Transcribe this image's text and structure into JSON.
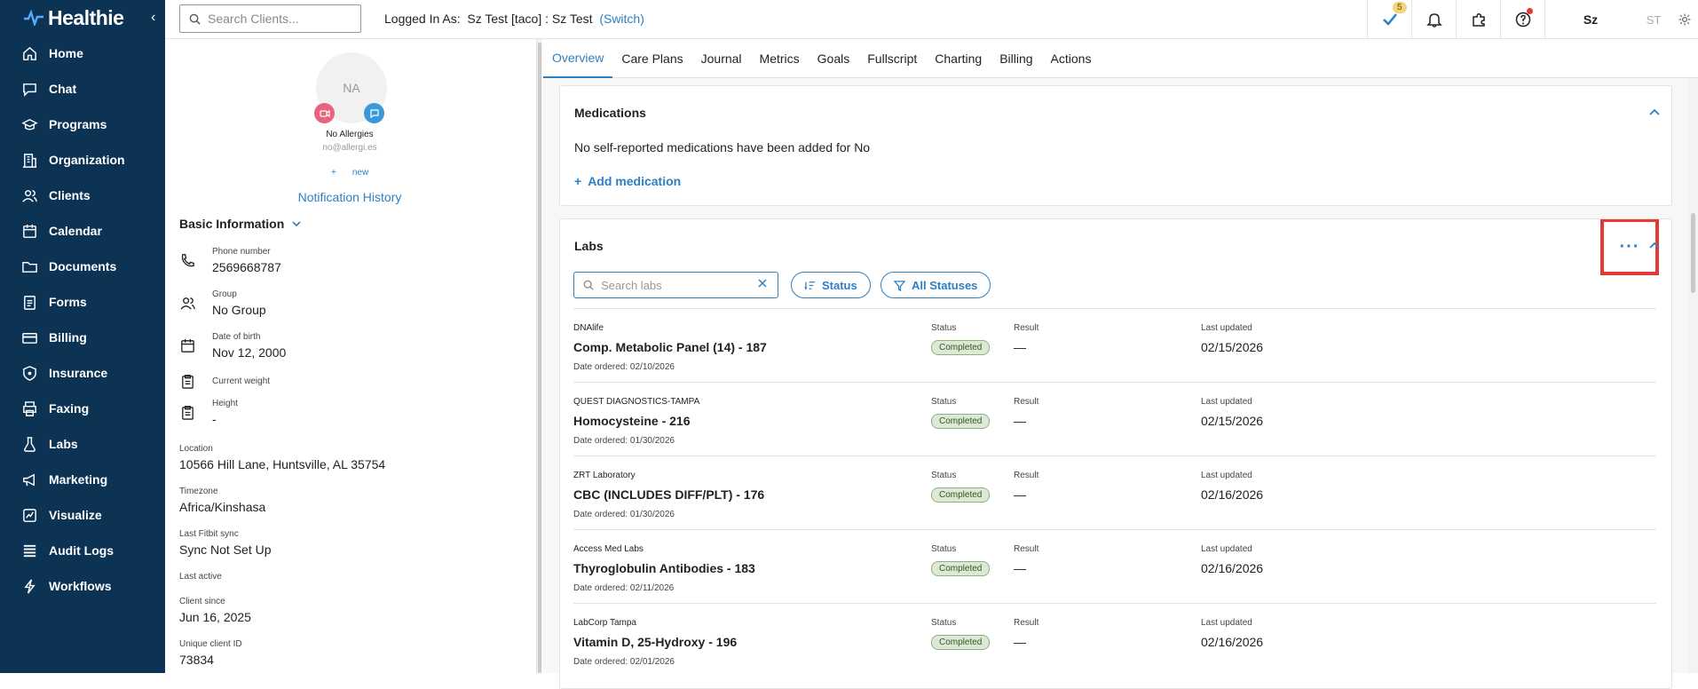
{
  "app": {
    "name": "Healthie"
  },
  "sidebar": {
    "items": [
      {
        "label": "Home",
        "icon": "home-icon"
      },
      {
        "label": "Chat",
        "icon": "chat-icon"
      },
      {
        "label": "Programs",
        "icon": "programs-icon"
      },
      {
        "label": "Organization",
        "icon": "organization-icon"
      },
      {
        "label": "Clients",
        "icon": "clients-icon"
      },
      {
        "label": "Calendar",
        "icon": "calendar-icon"
      },
      {
        "label": "Documents",
        "icon": "documents-icon"
      },
      {
        "label": "Forms",
        "icon": "forms-icon"
      },
      {
        "label": "Billing",
        "icon": "billing-icon"
      },
      {
        "label": "Insurance",
        "icon": "insurance-icon"
      },
      {
        "label": "Faxing",
        "icon": "fax-icon"
      },
      {
        "label": "Labs",
        "icon": "labs-icon"
      },
      {
        "label": "Marketing",
        "icon": "marketing-icon"
      },
      {
        "label": "Visualize",
        "icon": "visualize-icon"
      },
      {
        "label": "Audit Logs",
        "icon": "audit-logs-icon"
      },
      {
        "label": "Workflows",
        "icon": "workflows-icon"
      }
    ]
  },
  "topbar": {
    "search_placeholder": "Search Clients...",
    "logged_in_label": "Logged In As:",
    "logged_in_user": "Sz Test [taco] : Sz Test",
    "switch_label": "(Switch)",
    "tasks_badge": "5",
    "user_initials": "Sz",
    "secondary_initials": "ST"
  },
  "client": {
    "avatar_initials": "NA",
    "allergies": "No Allergies",
    "email": "no@allergi.es",
    "new_label": "new",
    "notification_history": "Notification History",
    "basic_info_title": "Basic Information",
    "phone_label": "Phone number",
    "phone_value": "2569668787",
    "group_label": "Group",
    "group_value": "No Group",
    "dob_label": "Date of birth",
    "dob_value": "Nov 12, 2000",
    "weight_label": "Current weight",
    "height_label": "Height",
    "height_value": "-",
    "location_label": "Location",
    "location_value": "10566 Hill Lane, Huntsville, AL 35754",
    "timezone_label": "Timezone",
    "timezone_value": "Africa/Kinshasa",
    "fitbit_label": "Last Fitbit sync",
    "fitbit_value": "Sync Not Set Up",
    "last_active_label": "Last active",
    "client_since_label": "Client since",
    "client_since_value": "Jun 16, 2025",
    "client_id_label": "Unique client ID",
    "client_id_value": "73834"
  },
  "tabs": [
    "Overview",
    "Care Plans",
    "Journal",
    "Metrics",
    "Goals",
    "Fullscript",
    "Charting",
    "Billing",
    "Actions"
  ],
  "medications": {
    "title": "Medications",
    "empty_text": "No self-reported medications have been added for No",
    "add_label": "Add medication"
  },
  "labs": {
    "title": "Labs",
    "more_label": "···",
    "search_placeholder": "Search labs",
    "status_filter": "Status",
    "all_statuses": "All Statuses",
    "rows": [
      {
        "provider": "DNAlife",
        "name": "Comp. Metabolic Panel (14) - 187",
        "ordered": "Date ordered: 02/10/2026",
        "status_label": "Status",
        "status": "Completed",
        "result_label": "Result",
        "result": "—",
        "updated_label": "Last updated",
        "updated": "02/15/2026"
      },
      {
        "provider": "QUEST DIAGNOSTICS-TAMPA",
        "name": "Homocysteine - 216",
        "ordered": "Date ordered: 01/30/2026",
        "status_label": "Status",
        "status": "Completed",
        "result_label": "Result",
        "result": "—",
        "updated_label": "Last updated",
        "updated": "02/15/2026"
      },
      {
        "provider": "ZRT Laboratory",
        "name": "CBC (INCLUDES DIFF/PLT) - 176",
        "ordered": "Date ordered: 01/30/2026",
        "status_label": "Status",
        "status": "Completed",
        "result_label": "Result",
        "result": "—",
        "updated_label": "Last updated",
        "updated": "02/16/2026"
      },
      {
        "provider": "Access Med Labs",
        "name": "Thyroglobulin Antibodies - 183",
        "ordered": "Date ordered: 02/11/2026",
        "status_label": "Status",
        "status": "Completed",
        "result_label": "Result",
        "result": "—",
        "updated_label": "Last updated",
        "updated": "02/16/2026"
      },
      {
        "provider": "LabCorp Tampa",
        "name": "Vitamin D, 25-Hydroxy - 196",
        "ordered": "Date ordered: 02/01/2026",
        "status_label": "Status",
        "status": "Completed",
        "result_label": "Result",
        "result": "—",
        "updated_label": "Last updated",
        "updated": "02/16/2026"
      }
    ]
  },
  "colors": {
    "sidebar": "#0d3354",
    "accent": "#2d7fc2",
    "highlight": "#e53935"
  }
}
